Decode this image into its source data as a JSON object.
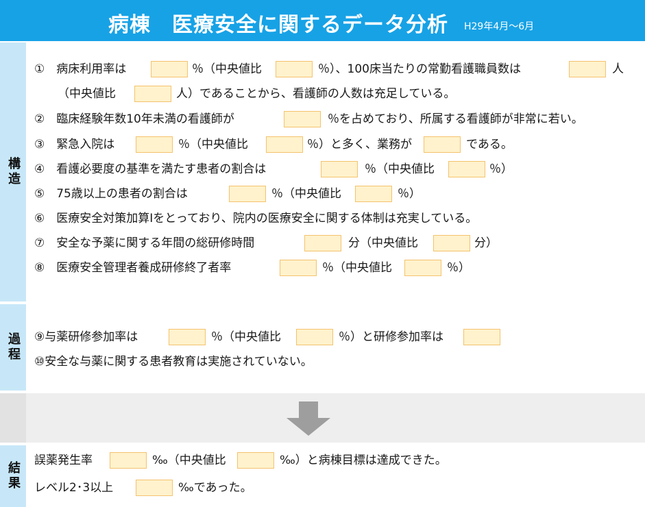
{
  "header": {
    "title": "病棟　医療安全に関するデータ分析",
    "period": "H29年4月～6月"
  },
  "colors": {
    "header_bg": "#17a2e6",
    "side_bg": "#c7e7f8",
    "blank_fill": "#fff2cc",
    "blank_border": "#f4c26e",
    "arrow": "#9e9e9e"
  },
  "structure": {
    "label": "構造",
    "items": [
      {
        "t1": "①　病床利用率は",
        "t2": "％（中央値比",
        "t3": "％）、100床当たりの常勤看護職員数は",
        "t4": "人"
      },
      {
        "t1": "（中央値比",
        "t2": "人）であることから、看護師の人数は充足している。"
      },
      {
        "t1": "②　臨床経験年数10年未満の看護師が",
        "t2": "％を占めており、所属する看護師が非常に若い。"
      },
      {
        "t1": "③　緊急入院は",
        "t2": "％（中央値比",
        "t3": "％）と多く、業務が",
        "t4": "である。"
      },
      {
        "t1": "④　看護必要度の基準を満たす患者の割合は",
        "t2": "％（中央値比",
        "t3": "％）"
      },
      {
        "t1": "⑤　75歳以上の患者の割合は",
        "t2": "％（中央値比",
        "t3": "％）"
      },
      {
        "t1": "⑥　医療安全対策加算Ⅰをとっており、院内の医療安全に関する体制は充実している。"
      },
      {
        "t1": "⑦　安全な予薬に関する年間の総研修時間",
        "t2": "分（中央値比",
        "t3": "分）"
      },
      {
        "t1": "⑧　医療安全管理者養成研修終了者率",
        "t2": "％（中央値比",
        "t3": "％）"
      }
    ]
  },
  "process": {
    "label": "過程",
    "items": [
      {
        "t1": "⑨与薬研修参加率は",
        "t2": "％（中央値比",
        "t3": "％）と研修参加率は"
      },
      {
        "t1": "⑩安全な与薬に関する患者教育は実施されていない。"
      }
    ]
  },
  "result": {
    "label": "結果",
    "items": [
      {
        "t1": "誤薬発生率",
        "t2": "‰（中央値比",
        "t3": "‰）と病棟目標は達成できた。"
      },
      {
        "t1": "レベル2･3以上",
        "t2": "‰であった。"
      }
    ]
  }
}
